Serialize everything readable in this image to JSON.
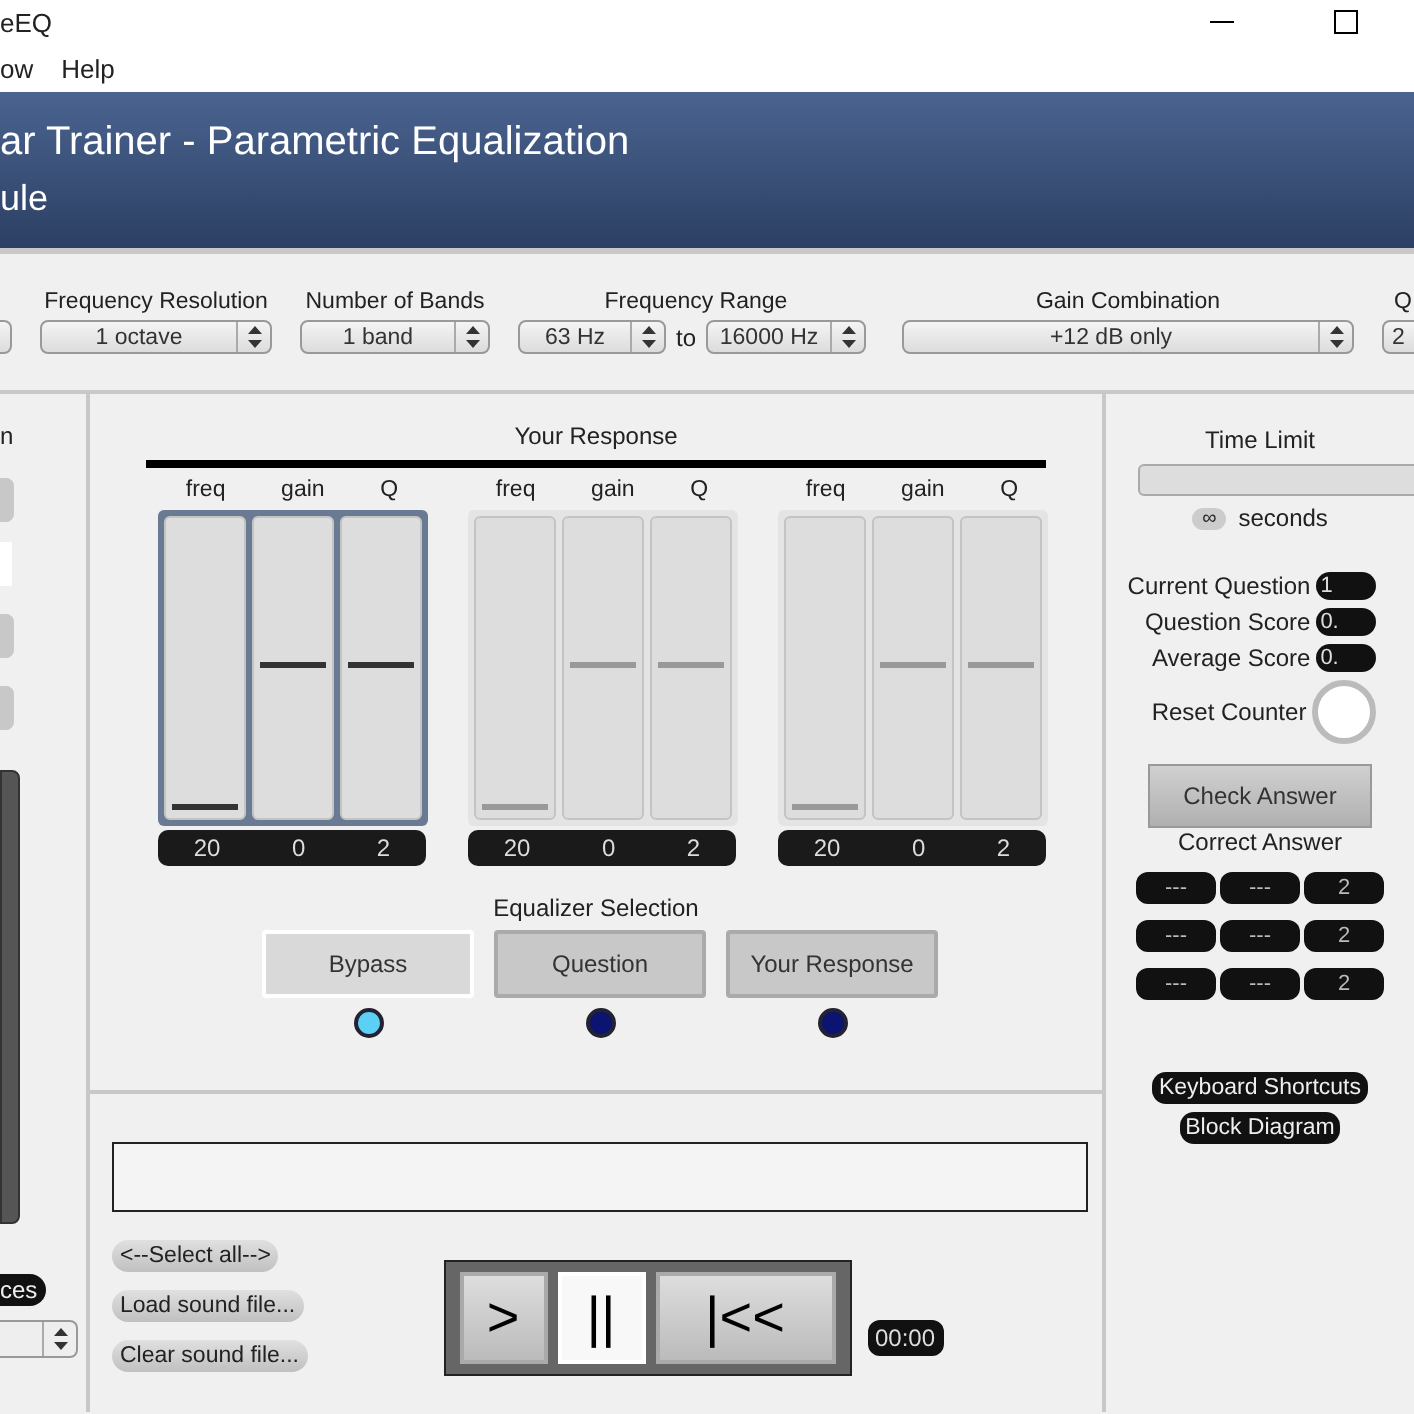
{
  "window": {
    "title": "eEQ"
  },
  "menu": [
    "ow",
    "Help"
  ],
  "header": {
    "title": "ar Trainer - Parametric Equalization",
    "subtitle": "ule"
  },
  "settings": [
    {
      "kind": "stub"
    },
    {
      "kind": "select",
      "label": "Frequency Resolution",
      "value": "1 octave"
    },
    {
      "kind": "select",
      "label": "Number of Bands",
      "value": "1 band"
    },
    {
      "kind": "range",
      "label": "Frequency Range",
      "from": "63 Hz",
      "joiner": "to",
      "to": "16000 Hz"
    },
    {
      "kind": "select",
      "label": "Gain Combination",
      "value": "+12 dB only"
    },
    {
      "kind": "select",
      "label": "Q",
      "value": "2"
    }
  ],
  "left_strip": {
    "label": "n",
    "pill": "ces"
  },
  "response": {
    "title": "Your Response",
    "bands": [
      {
        "selected": true,
        "sliders": [
          {
            "label": "freq",
            "level": 0.03,
            "value": "20"
          },
          {
            "label": "gain",
            "level": 0.5,
            "value": "0"
          },
          {
            "label": "Q",
            "level": 0.5,
            "value": "2"
          }
        ]
      },
      {
        "selected": false,
        "sliders": [
          {
            "label": "freq",
            "level": 0.03,
            "value": "20"
          },
          {
            "label": "gain",
            "level": 0.5,
            "value": "0"
          },
          {
            "label": "Q",
            "level": 0.5,
            "value": "2"
          }
        ]
      },
      {
        "selected": false,
        "sliders": [
          {
            "label": "freq",
            "level": 0.03,
            "value": "20"
          },
          {
            "label": "gain",
            "level": 0.5,
            "value": "0"
          },
          {
            "label": "Q",
            "level": 0.5,
            "value": "2"
          }
        ]
      }
    ]
  },
  "equalizer_selection": {
    "title": "Equalizer Selection",
    "options": [
      {
        "label": "Bypass",
        "selected": true
      },
      {
        "label": "Question",
        "selected": false
      },
      {
        "label": "Your Response",
        "selected": false
      }
    ]
  },
  "player": {
    "select_all": "<--Select all-->",
    "load": "Load sound file...",
    "clear": "Clear sound file...",
    "transport": [
      {
        "label": ">",
        "selected": false
      },
      {
        "label": "||",
        "selected": true
      },
      {
        "label": "|<<",
        "selected": false
      }
    ],
    "time": "00:00"
  },
  "quiz": {
    "time_limit": "Time Limit",
    "limit_value": "∞",
    "limit_unit": "seconds",
    "stats": [
      {
        "label": "Current Question",
        "value": "1"
      },
      {
        "label": "Question Score",
        "value": "0."
      },
      {
        "label": "Average Score",
        "value": "0."
      }
    ],
    "reset": "Reset Counter",
    "check": "Check Answer",
    "correct_title": "Correct Answer",
    "correct": [
      [
        "---",
        "---",
        "2"
      ],
      [
        "---",
        "---",
        "2"
      ],
      [
        "---",
        "---",
        "2"
      ]
    ],
    "keyboard": "Keyboard Shortcuts",
    "block": "Block Diagram"
  }
}
